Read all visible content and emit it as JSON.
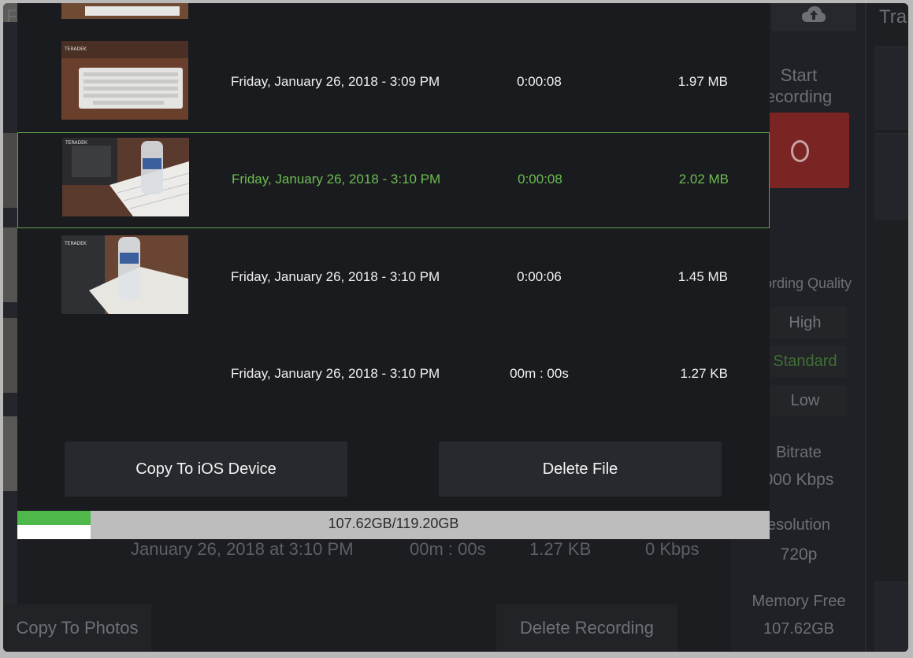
{
  "background": {
    "header_left_glyph": "F",
    "header_right_glyph": "Tra",
    "start_recording_label": "Start\necording",
    "recording_quality_label": "ording Quality",
    "quality_options": [
      {
        "label": "High",
        "selected": false
      },
      {
        "label": "Standard",
        "selected": true
      },
      {
        "label": "Low",
        "selected": false
      }
    ],
    "bitrate_label": "Bitrate",
    "bitrate_value": "000 Kbps",
    "resolution_label": "esolution",
    "resolution_value": "720p",
    "memory_free_label": "Memory Free",
    "memory_free_value": "107.62GB",
    "recording_row": {
      "date": "January 26, 2018 at 3:10 PM",
      "duration": "00m : 00s",
      "size": "1.27 KB",
      "bitrate": "0 Kbps"
    },
    "copy_to_photos_label": "Copy To Photos",
    "delete_recording_label": "Delete Recording"
  },
  "file_list": [
    {
      "date": "Friday, January 26, 2018 - 3:09 PM",
      "duration": "0:00:08",
      "size": "1.97 MB",
      "selected": false
    },
    {
      "date": "Friday, January 26, 2018 - 3:10 PM",
      "duration": "0:00:08",
      "size": "2.02 MB",
      "selected": true
    },
    {
      "date": "Friday, January 26, 2018 - 3:10 PM",
      "duration": "0:00:06",
      "size": "1.45 MB",
      "selected": false
    },
    {
      "date": "Friday, January 26, 2018 - 3:10 PM",
      "duration": "00m : 00s",
      "size": "1.27 KB",
      "selected": false
    }
  ],
  "actions": {
    "copy_label": "Copy To iOS Device",
    "delete_label": "Delete File"
  },
  "storage": {
    "text": "107.62GB/119.20GB",
    "used_fraction": 0.097
  },
  "colors": {
    "selected": "#6cbd4f",
    "storage_green": "#4fb84a",
    "record_red": "#7a2424"
  }
}
